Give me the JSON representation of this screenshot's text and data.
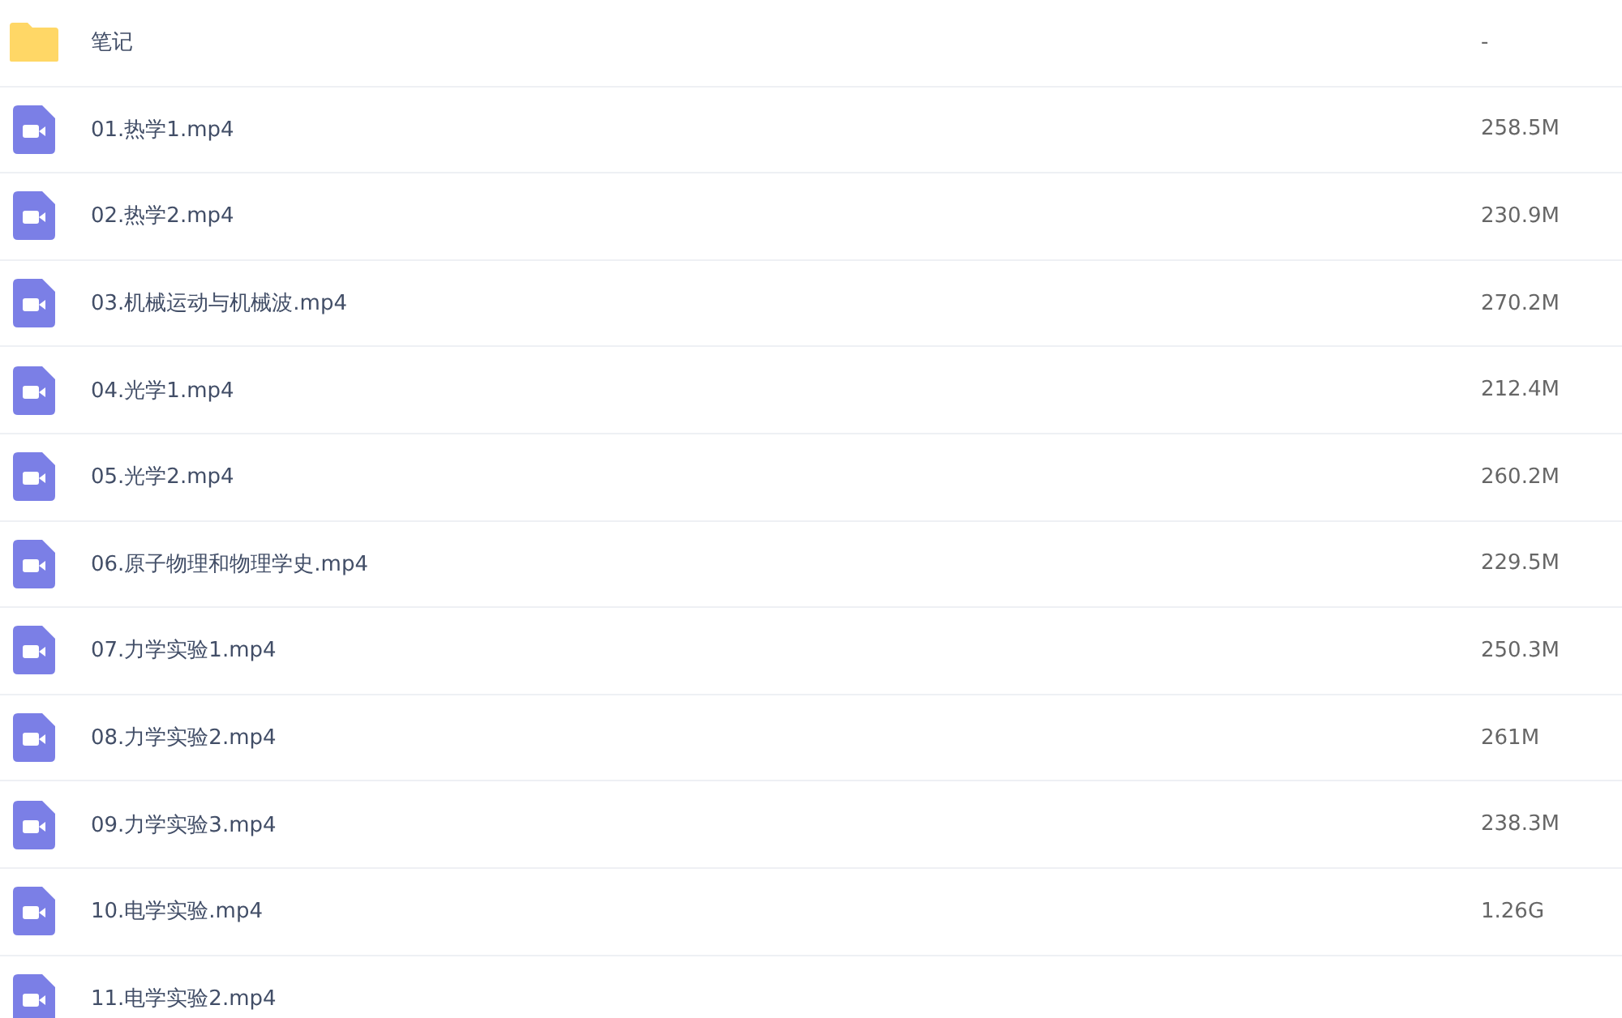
{
  "files": [
    {
      "kind": "folder",
      "name": "笔记",
      "size": "-"
    },
    {
      "kind": "video",
      "name": "01.热学1.mp4",
      "size": "258.5M"
    },
    {
      "kind": "video",
      "name": "02.热学2.mp4",
      "size": "230.9M"
    },
    {
      "kind": "video",
      "name": "03.机械运动与机械波.mp4",
      "size": "270.2M"
    },
    {
      "kind": "video",
      "name": "04.光学1.mp4",
      "size": "212.4M"
    },
    {
      "kind": "video",
      "name": "05.光学2.mp4",
      "size": "260.2M"
    },
    {
      "kind": "video",
      "name": "06.原子物理和物理学史.mp4",
      "size": "229.5M"
    },
    {
      "kind": "video",
      "name": "07.力学实验1.mp4",
      "size": "250.3M"
    },
    {
      "kind": "video",
      "name": "08.力学实验2.mp4",
      "size": "261M"
    },
    {
      "kind": "video",
      "name": "09.力学实验3.mp4",
      "size": "238.3M"
    },
    {
      "kind": "video",
      "name": "10.电学实验.mp4",
      "size": "1.26G"
    },
    {
      "kind": "video",
      "name": "11.电学实验2.mp4"
    }
  ]
}
